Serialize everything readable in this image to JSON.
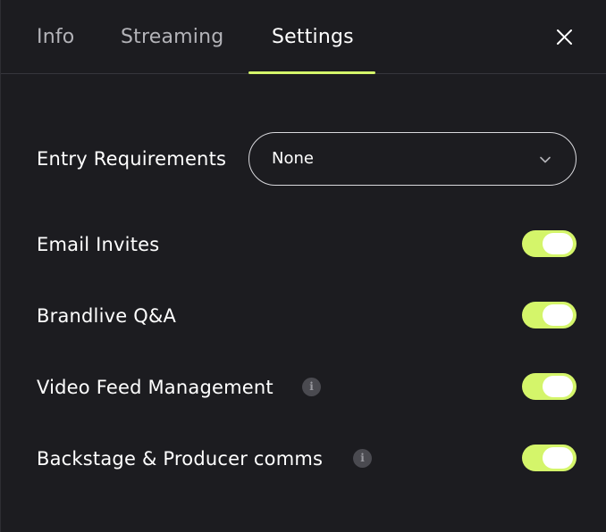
{
  "tabs": [
    {
      "label": "Info",
      "active": false
    },
    {
      "label": "Streaming",
      "active": false
    },
    {
      "label": "Settings",
      "active": true
    }
  ],
  "colors": {
    "background": "#1c1c20",
    "accent": "#d4f56a",
    "text": "#ffffff",
    "muted_text": "#b3b3b8"
  },
  "close_icon": "close-icon",
  "settings": {
    "entry_requirements": {
      "label": "Entry Requirements",
      "selected": "None",
      "icon": "chevron-down-icon"
    },
    "email_invites": {
      "label": "Email Invites",
      "enabled": true
    },
    "brandlive_qa": {
      "label": "Brandlive Q&A",
      "enabled": true
    },
    "video_feed_management": {
      "label": "Video Feed Management",
      "enabled": true,
      "info_icon": "info-icon"
    },
    "backstage_comms": {
      "label": "Backstage & Producer comms",
      "enabled": true,
      "info_icon": "info-icon"
    }
  }
}
